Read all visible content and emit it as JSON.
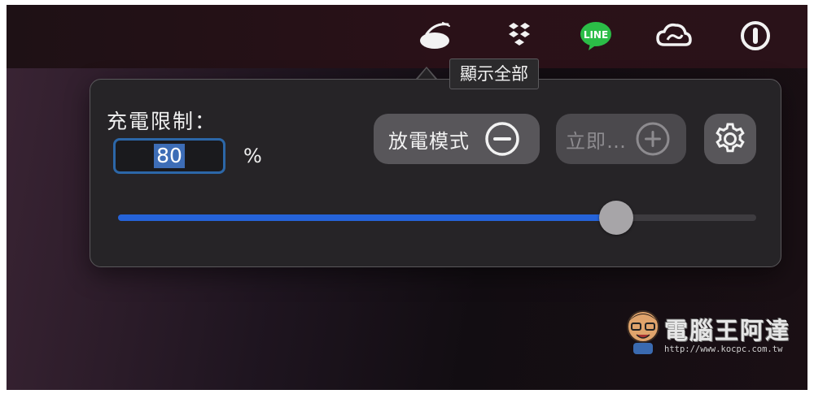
{
  "menubar": {
    "icons": [
      {
        "name": "al-dente-icon"
      },
      {
        "name": "dropbox-icon"
      },
      {
        "name": "line-icon",
        "text": "LINE",
        "color": "#2bbd47"
      },
      {
        "name": "creative-cloud-icon"
      },
      {
        "name": "power-icon"
      }
    ]
  },
  "tooltip": {
    "text": "顯示全部"
  },
  "popover": {
    "limit_label": "充電限制：",
    "limit_value": "80",
    "percent_sign": "%",
    "discharge_label": "放電模式",
    "top_up_label": "立即…",
    "slider_value_percent": 78,
    "accent_color": "#2563d9"
  },
  "watermark": {
    "title": "電腦王阿達",
    "url": "http://www.kocpc.com.tw"
  }
}
